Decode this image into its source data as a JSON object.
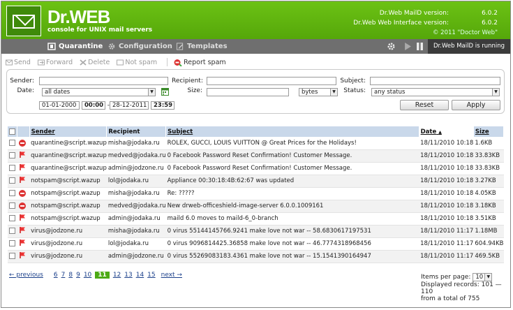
{
  "header": {
    "brand": "Dr.WEB",
    "subtitle": "console for UNIX mail servers",
    "versions": [
      {
        "label": "Dr.Web MailD version:",
        "value": "6.0.2"
      },
      {
        "label": "Dr.Web Web Interface version:",
        "value": "6.0.2"
      }
    ],
    "copyright": "© 2011 \"Doctor Web\""
  },
  "nav": {
    "tabs": [
      {
        "label": "Quarantine",
        "icon": "quarantine-icon"
      },
      {
        "label": "Configuration",
        "icon": "gear-icon"
      },
      {
        "label": "Templates",
        "icon": "edit-icon"
      }
    ],
    "status": "Dr.Web MailD is running"
  },
  "toolbar": {
    "send": "Send",
    "forward": "Forward",
    "delete": "Delete",
    "not_spam": "Not spam",
    "report_spam": "Report spam"
  },
  "filter": {
    "sender_label": "Sender:",
    "date_label": "Date:",
    "recipient_label": "Recipient:",
    "size_label": "Size:",
    "subject_label": "Subject:",
    "status_label": "Status:",
    "date_select": "all dates",
    "size_unit": "bytes",
    "status_select": "any status",
    "date_from": "01-01-2000",
    "time_from": "00:00",
    "date_to": "28-12-2011",
    "time_to": "23:59",
    "dash": "-",
    "reset": "Reset",
    "apply": "Apply"
  },
  "table": {
    "headers": {
      "sender": "Sender",
      "recipient": "Recipient",
      "subject": "Subject",
      "date": "Date",
      "size": "Size"
    },
    "rows": [
      {
        "icon": "red",
        "sender": "quarantine@script.wazup",
        "recipient": "misha@jodaka.ru",
        "subject": "ROLEX, GUCCI, LOUIS VUITTON @ Great Prices for the Holidays!",
        "date": "18/11/2010 10:18",
        "size": "1.6KB"
      },
      {
        "icon": "flag",
        "sender": "quarantine@script.wazup",
        "recipient": "medved@jodaka.ru",
        "subject": "0 Facebook Password Reset Confirmation! Customer Message.",
        "date": "18/11/2010 10:18",
        "size": "33.83KB"
      },
      {
        "icon": "flag",
        "sender": "quarantine@script.wazup",
        "recipient": "admin@jodzone.ru",
        "subject": "0 Facebook Password Reset Confirmation! Customer Message.",
        "date": "18/11/2010 10:18",
        "size": "33.83KB"
      },
      {
        "icon": "flag",
        "sender": "notspam@script.wazup",
        "recipient": "lol@jodaka.ru",
        "subject": "Appliance 00:30:18:4B:62:67 was updated",
        "date": "18/11/2010 10:18",
        "size": "3.27KB"
      },
      {
        "icon": "red",
        "sender": "notspam@script.wazup",
        "recipient": "misha@jodaka.ru",
        "subject": "Re: ?????",
        "date": "18/11/2010 10:18",
        "size": "4.05KB"
      },
      {
        "icon": "red",
        "sender": "notspam@script.wazup",
        "recipient": "medved@jodaka.ru",
        "subject": "New drweb-officeshield-image-server 6.0.0.1009161",
        "date": "18/11/2010 10:18",
        "size": "3.18KB"
      },
      {
        "icon": "flag",
        "sender": "notspam@script.wazup",
        "recipient": "admin@jodaka.ru",
        "subject": "maild 6.0 moves to maild-6_0-branch",
        "date": "18/11/2010 10:18",
        "size": "3.51KB"
      },
      {
        "icon": "flag",
        "sender": "virus@jodzone.ru",
        "recipient": "misha@jodaka.ru",
        "subject": "0 virus 55144145766.9241 make love not war -- 58.6830617197531",
        "date": "18/11/2010 11:17",
        "size": "1.18MB"
      },
      {
        "icon": "flag",
        "sender": "virus@jodzone.ru",
        "recipient": "lol@jodaka.ru",
        "subject": "0 virus 9096814425.36858 make love not war -- 46.7774318968456",
        "date": "18/11/2010 11:17",
        "size": "604.94KB"
      },
      {
        "icon": "flag",
        "sender": "virus@jodzone.ru",
        "recipient": "admin@jodzone.ru",
        "subject": "0 virus 55269083183.4361 make love not war -- 15.1541390164947",
        "date": "18/11/2010 11:17",
        "size": "469.5KB"
      }
    ]
  },
  "pager": {
    "previous": "← previous",
    "pages": [
      "6",
      "7",
      "8",
      "9",
      "10",
      "11",
      "12",
      "13",
      "14",
      "15"
    ],
    "current": "11",
    "next": "next →"
  },
  "footer": {
    "items_per_page_label": "Items per page:",
    "items_per_page": "10",
    "displayed": "Displayed records: 101 — 110",
    "total": "from a total of 755"
  }
}
